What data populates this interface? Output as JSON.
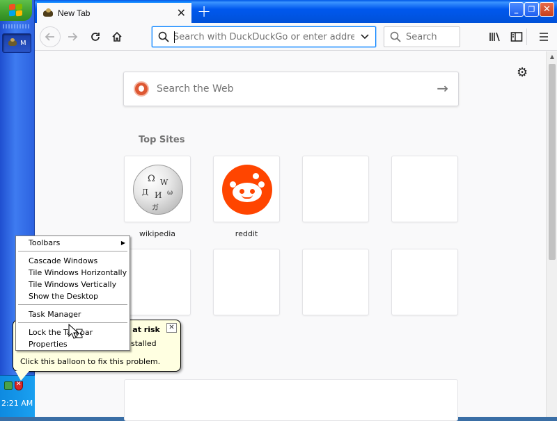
{
  "browser": {
    "tab_title": "New Tab",
    "url_placeholder": "Search with DuckDuckGo or enter address",
    "search_label": "Search"
  },
  "newtab": {
    "web_search_label": "Search the Web",
    "top_sites_title": "Top Sites",
    "sites": [
      {
        "label": "wikipedia"
      },
      {
        "label": "reddit"
      }
    ]
  },
  "context_menu": {
    "items": [
      "Toolbars",
      "Cascade Windows",
      "Tile Windows Horizontally",
      "Tile Windows Vertically",
      "Show the Desktop",
      "Task Manager",
      "Lock the Taskbar",
      "Properties"
    ]
  },
  "balloon": {
    "title_fragment": "e at risk",
    "line2_fragment": "nstalled",
    "text": "Click this balloon to fix this problem."
  },
  "taskbar": {
    "clock": "2:21 AM",
    "task_button_label": "M"
  },
  "colors": {
    "accent": "#0a84ff",
    "taskbar_blue": "#3e7bf0",
    "start_green": "#3f9e2c",
    "reddit": "#ff4500",
    "ddg": "#de5833"
  }
}
